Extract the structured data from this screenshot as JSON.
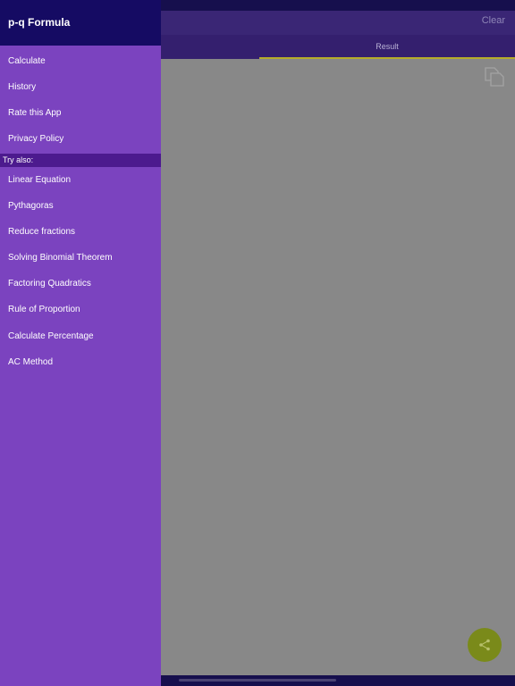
{
  "app": {
    "clear_label": "Clear",
    "tab_result_label": "Result"
  },
  "drawer": {
    "title": "p-q Formula",
    "main_items": [
      {
        "label": "Calculate"
      },
      {
        "label": "History"
      },
      {
        "label": "Rate this App"
      },
      {
        "label": "Privacy Policy"
      }
    ],
    "section_label": "Try also:",
    "try_items": [
      {
        "label": "Linear Equation"
      },
      {
        "label": "Pythagoras"
      },
      {
        "label": "Reduce fractions"
      },
      {
        "label": "Solving Binomial Theorem"
      },
      {
        "label": "Factoring Quadratics"
      },
      {
        "label": "Rule of Proportion"
      },
      {
        "label": "Calculate Percentage"
      },
      {
        "label": "AC Method"
      }
    ]
  },
  "icons": {
    "copy": "copy-icon",
    "share": "share-icon"
  },
  "colors": {
    "drawer_bg": "#7b43bf",
    "drawer_header_bg": "#150b63",
    "section_bg": "#4c1a8e",
    "accent": "#b6ab2a",
    "share_button": "#7a8a1a"
  }
}
